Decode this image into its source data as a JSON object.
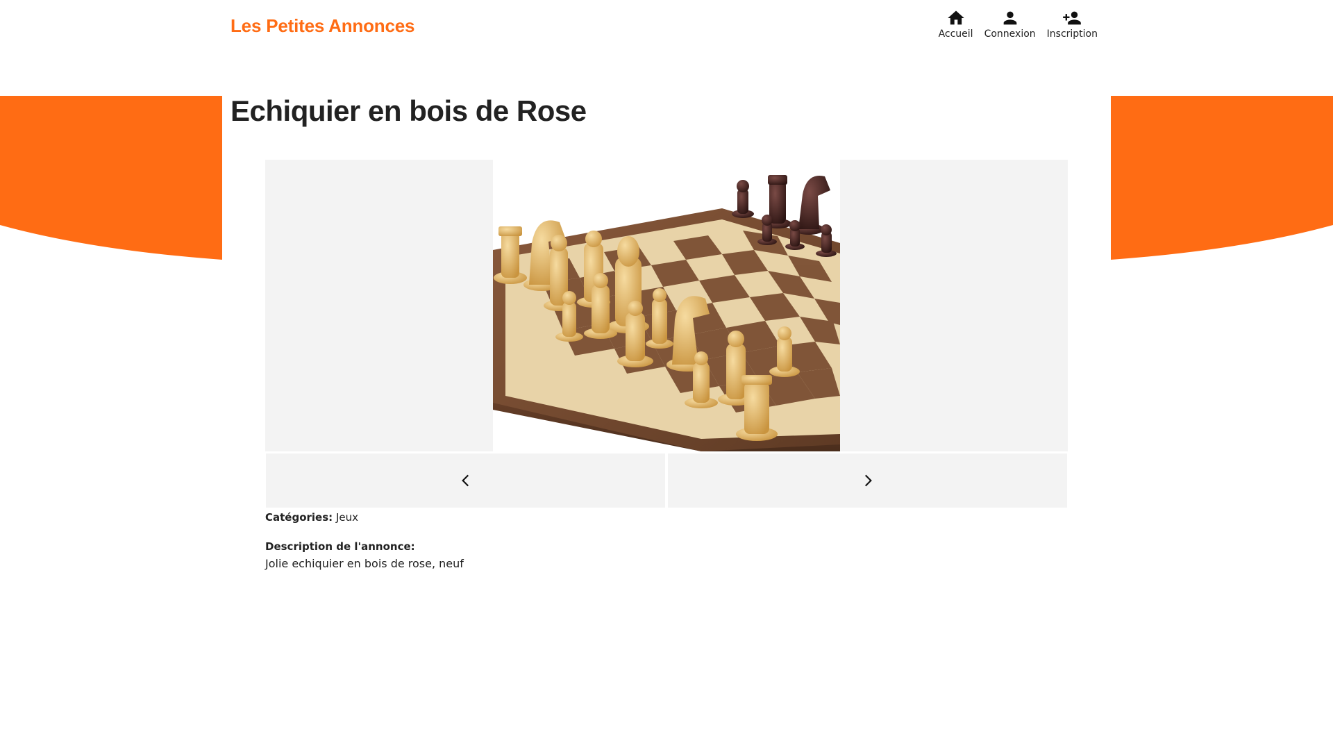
{
  "header": {
    "logo": "Les Petites Annonces",
    "nav": [
      {
        "label": "Accueil",
        "icon": "home-icon"
      },
      {
        "label": "Connexion",
        "icon": "person-icon"
      },
      {
        "label": "Inscription",
        "icon": "person-add-icon"
      }
    ]
  },
  "listing": {
    "title": "Echiquier en bois de Rose",
    "categories_label": "Catégories:",
    "categories_value": "Jeux",
    "description_label": "Description de l'annonce:",
    "description_text": "Jolie echiquier en bois de rose, neuf"
  },
  "carousel": {
    "prev_icon": "chevron-left-icon",
    "next_icon": "chevron-right-icon"
  },
  "colors": {
    "accent": "#ff6c14",
    "panel": "#f3f3f3",
    "text": "#222222"
  }
}
